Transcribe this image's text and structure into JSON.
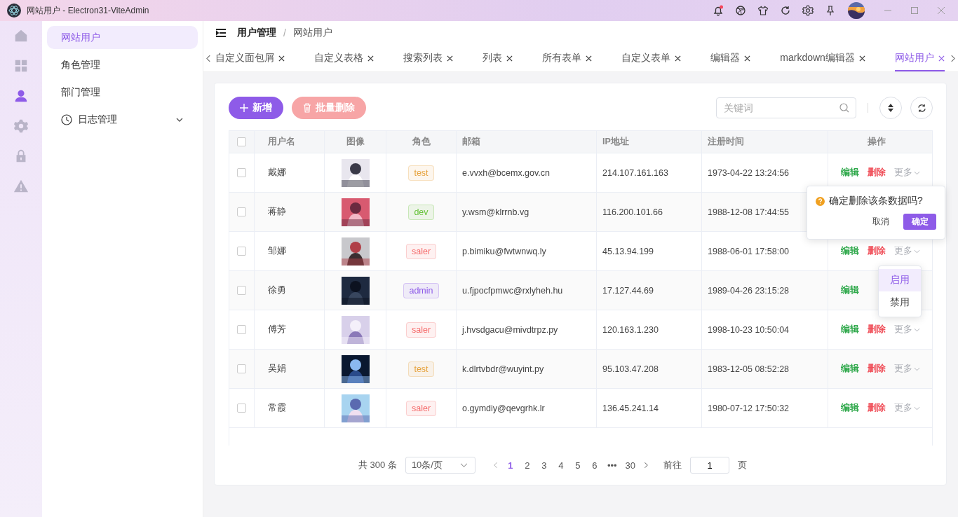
{
  "window": {
    "title": "网站用户 - Electron31-ViteAdmin"
  },
  "rail": [
    {
      "selected": false
    },
    {
      "selected": false
    },
    {
      "selected": true
    },
    {
      "selected": false
    },
    {
      "selected": false
    },
    {
      "selected": false
    }
  ],
  "menu": [
    {
      "label": "网站用户",
      "selected": true
    },
    {
      "label": "角色管理",
      "selected": false
    },
    {
      "label": "部门管理",
      "selected": false
    },
    {
      "label": "日志管理",
      "selected": false,
      "kind": "submenu",
      "expanded": false
    }
  ],
  "breadcrumb": [
    {
      "label": "用户管理",
      "current": false
    },
    {
      "label": "网站用户",
      "current": true
    }
  ],
  "breadcrumb_separator": "/",
  "tabs": [
    {
      "label": "自定义面包屑",
      "selected": false
    },
    {
      "label": "自定义表格",
      "selected": false
    },
    {
      "label": "搜索列表",
      "selected": false
    },
    {
      "label": "列表",
      "selected": false
    },
    {
      "label": "所有表单",
      "selected": false
    },
    {
      "label": "自定义表单",
      "selected": false
    },
    {
      "label": "编辑器",
      "selected": false
    },
    {
      "label": "markdown编辑器",
      "selected": false
    },
    {
      "label": "网站用户",
      "selected": true
    }
  ],
  "toolbar": {
    "add": "新增",
    "batch_delete": "批量删除",
    "batch_delete_disabled": true,
    "search": {
      "placeholder": "关键词"
    }
  },
  "table": {
    "select_all_checked": false,
    "columns": [
      "用户名",
      "图像",
      "角色",
      "邮箱",
      "IP地址",
      "注册时间",
      "操作"
    ],
    "rows": [
      {
        "checked": false,
        "name": "戴娜",
        "avatar": {
          "kind": "picture"
        },
        "role": {
          "label": "test",
          "color": "#e6a23c"
        },
        "email": "e.vvxh@bcemx.gov.cn",
        "ip": "214.107.161.163",
        "time": "1973-04-22 13:24:56",
        "actions": [
          {
            "kind": "edit",
            "label": "编辑"
          },
          {
            "kind": "delete",
            "label": "删除"
          },
          {
            "kind": "more",
            "label": "更多"
          }
        ]
      },
      {
        "checked": false,
        "name": "蒋静",
        "avatar": {
          "kind": "picture"
        },
        "role": {
          "label": "dev",
          "color": "#67c23a"
        },
        "email": "y.wsm@klrrnb.vg",
        "ip": "116.200.101.66",
        "time": "1988-12-08 17:44:55"
      },
      {
        "checked": false,
        "name": "邹娜",
        "avatar": {
          "kind": "picture"
        },
        "role": {
          "label": "saler",
          "color": "#f56c6c"
        },
        "email": "p.bimiku@fwtwnwq.ly",
        "ip": "45.13.94.199",
        "time": "1988-06-01 17:58:00",
        "actions": [
          {
            "kind": "edit",
            "label": "编辑"
          },
          {
            "kind": "delete",
            "label": "删除"
          },
          {
            "kind": "more",
            "label": "更多"
          }
        ]
      },
      {
        "checked": false,
        "name": "徐勇",
        "avatar": {
          "kind": "picture"
        },
        "role": {
          "label": "admin",
          "color": "#8e5be8"
        },
        "email": "u.fjpocfpmwc@rxlyheh.hu",
        "ip": "17.127.44.69",
        "time": "1989-04-26 23:15:28",
        "actions": [
          {
            "kind": "edit",
            "label": "编辑"
          }
        ]
      },
      {
        "checked": false,
        "name": "傅芳",
        "avatar": {
          "kind": "picture"
        },
        "role": {
          "label": "saler",
          "color": "#f56c6c"
        },
        "email": "j.hvsdgacu@mivdtrpz.py",
        "ip": "120.163.1.230",
        "time": "1998-10-23 10:50:04",
        "actions": [
          {
            "kind": "edit",
            "label": "编辑"
          },
          {
            "kind": "delete",
            "label": "删除"
          },
          {
            "kind": "more",
            "label": "更多"
          }
        ]
      },
      {
        "checked": false,
        "name": "吴娟",
        "avatar": {
          "kind": "picture"
        },
        "role": {
          "label": "test",
          "color": "#e6a23c"
        },
        "email": "k.dlrtvbdr@wuyint.py",
        "ip": "95.103.47.208",
        "time": "1983-12-05 08:52:28",
        "actions": [
          {
            "kind": "edit",
            "label": "编辑"
          },
          {
            "kind": "delete",
            "label": "删除"
          },
          {
            "kind": "more",
            "label": "更多"
          }
        ]
      },
      {
        "checked": false,
        "name": "常霞",
        "avatar": {
          "kind": "picture"
        },
        "role": {
          "label": "saler",
          "color": "#f56c6c"
        },
        "email": "o.gymdiy@qevgrhk.lr",
        "ip": "136.45.241.14",
        "time": "1980-07-12 17:50:32",
        "actions": [
          {
            "kind": "edit",
            "label": "编辑"
          },
          {
            "kind": "delete",
            "label": "删除"
          },
          {
            "kind": "more",
            "label": "更多"
          }
        ]
      }
    ]
  },
  "popconfirm": {
    "message": "确定删除该条数据吗?",
    "cancel": "取消",
    "confirm": "确定"
  },
  "dropdown": [
    {
      "label": "启用",
      "selected": true
    },
    {
      "label": "禁用",
      "selected": false
    }
  ],
  "pagination": {
    "total": "共 300 条",
    "page_size": "10条/页",
    "pages": [
      {
        "label": "1",
        "selected": true
      },
      {
        "label": "2",
        "selected": false
      },
      {
        "label": "3",
        "selected": false
      },
      {
        "label": "4",
        "selected": false
      },
      {
        "label": "5",
        "selected": false
      },
      {
        "label": "6",
        "selected": false
      },
      {
        "label": "•••",
        "selected": false
      },
      {
        "label": "30",
        "selected": false
      }
    ],
    "goto": "前往",
    "goto_value": "1",
    "page_unit": "页"
  }
}
